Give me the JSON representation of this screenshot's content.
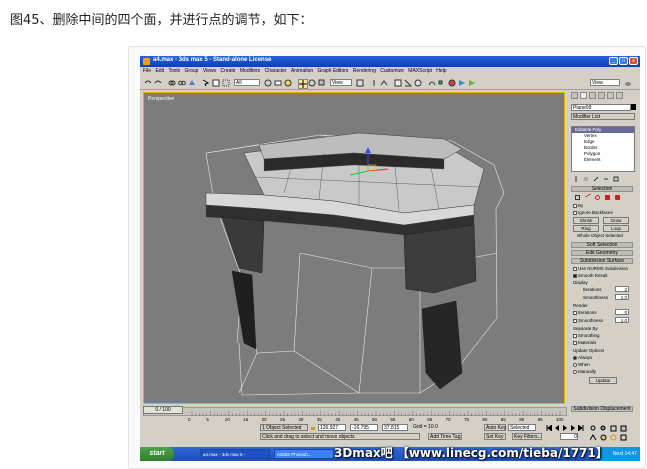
{
  "caption": "图45、删除中间的四个面，并进行点的调节，如下：",
  "window": {
    "title": "a4.max - 3ds max 5 - Stand-alone License"
  },
  "menu": [
    "File",
    "Edit",
    "Tools",
    "Group",
    "Views",
    "Create",
    "Modifiers",
    "Character",
    "Animation",
    "Graph Editors",
    "Rendering",
    "Customize",
    "MAXScript",
    "Help"
  ],
  "toolbar": {
    "selection_filter": "All",
    "ref_coord": "View",
    "named_sel": "View"
  },
  "viewport": {
    "label": "Perspective"
  },
  "command_panel": {
    "object_name": "Plane09",
    "modifier_list": "Modifier List",
    "stack": {
      "top": "Editable Poly",
      "subs": [
        "Vertex",
        "Edge",
        "Border",
        "Polygon",
        "Element"
      ]
    },
    "selection": {
      "header": "Selection",
      "by": "By",
      "ignore_backfaces": "Ignore Backfaces",
      "shrink": "Shrink",
      "grow": "Grow",
      "ring": "Ring",
      "loop": "Loop",
      "status": "Whole Object Selected"
    },
    "soft_selection": "Soft Selection",
    "edit_geometry": "Edit Geometry",
    "subdivision": {
      "header": "Subdivision Surface",
      "use_nurms": "Use NURMS Subdivision",
      "smooth_result": "Smooth Result",
      "display": "Display",
      "iterations_label": "Iterations",
      "iterations_display": "2",
      "smoothness_label": "Smoothness",
      "smoothness_display": "1.0",
      "render": "Render",
      "iterations_render": "0",
      "smoothness_render": "1.0",
      "separate_by": "Separate By",
      "smoothing": "Smoothing",
      "materials": "Materials",
      "update_options": "Update Options",
      "always": "Always",
      "when_rendering": "When",
      "manually": "Manually",
      "update": "Update"
    },
    "subdivision_displacement": "Subdivision Displacement"
  },
  "timeline": {
    "slider": "0 / 100",
    "ticks": [
      "0",
      "5",
      "10",
      "15",
      "20",
      "25",
      "30",
      "35",
      "40",
      "45",
      "50",
      "55",
      "60",
      "65",
      "70",
      "75",
      "80",
      "85",
      "90",
      "95",
      "100"
    ]
  },
  "status": {
    "selected": "1 Object Selected",
    "hint": "Click and drag to select and move objects",
    "x": "126.927",
    "y": "-16.795",
    "z": "37.815",
    "grid": "Grid = 10.0",
    "add_time_tag": "Add Time Tag",
    "auto_key": "Auto Key",
    "auto_key_mode": "Selected",
    "set_key": "Set Key",
    "key_filters": "Key Filters...",
    "frame": "0"
  },
  "taskbar": {
    "start": "start",
    "tasks": [
      "a4.max - 3ds max 5 -",
      "Adobe Photosh..."
    ],
    "clock": "Next 14:47"
  },
  "watermark": "3Dmax吧 【www.linecg.com/tieba/1771】",
  "colors": {
    "viewport_bg": "#7c7c7c",
    "active_border": "#e2b300",
    "ui_gray": "#d4d0c8",
    "title_blue": "#0a3fb8"
  }
}
